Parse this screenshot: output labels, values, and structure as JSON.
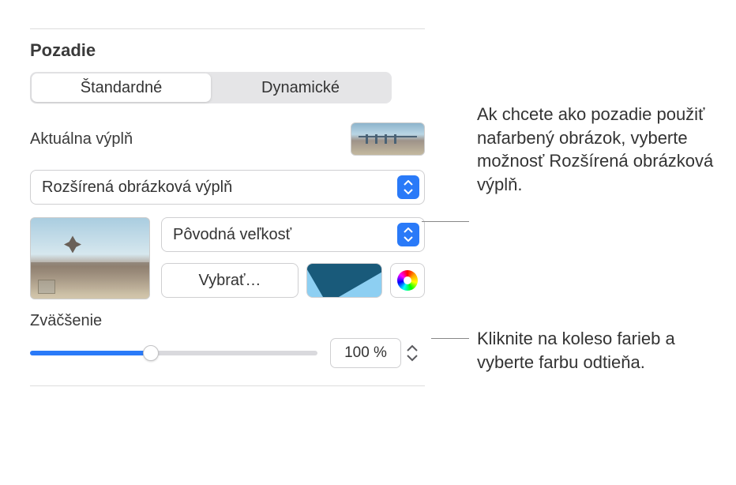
{
  "section_title": "Pozadie",
  "segments": {
    "standard": "Štandardné",
    "dynamic": "Dynamické"
  },
  "current_fill_label": "Aktuálna výplň",
  "fill_type": "Rozšírená obrázková výplň",
  "scale_option": "Pôvodná veľkosť",
  "choose_button": "Vybrať…",
  "zoom_label": "Zväčšenie",
  "zoom_value": "100 %",
  "callouts": {
    "advanced_fill": "Ak chcete ako pozadie použiť nafarbený obrázok, vyberte možnosť Rozšírená obrázková výplň.",
    "color_wheel": "Kliknite na koleso farieb a vyberte farbu odtieňa."
  },
  "icons": {
    "popup_arrows": "popup-updown-arrows",
    "stepper_up": "caret-up",
    "stepper_down": "caret-down",
    "color_wheel": "color-wheel-icon"
  },
  "colors": {
    "accent": "#2a7af8",
    "tint_light": "#8dcff2",
    "tint_dark": "#195a7a"
  }
}
